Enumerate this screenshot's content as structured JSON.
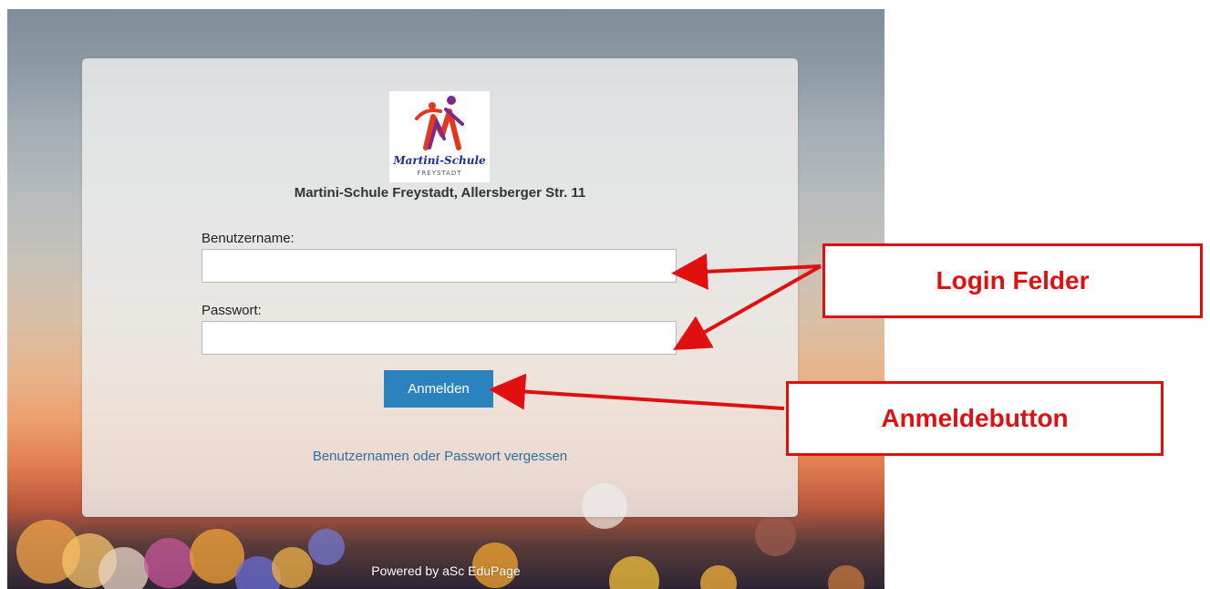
{
  "school": {
    "logo_title": "Martini-Schule",
    "logo_subtitle": "FREYSTADT",
    "name": "Martini-Schule Freystadt, Allersberger Str. 11"
  },
  "form": {
    "username_label": "Benutzername:",
    "username_value": "",
    "password_label": "Passwort:",
    "password_value": "",
    "login_button": "Anmelden",
    "forgot_link": "Benutzernamen oder Passwort vergessen"
  },
  "footer": {
    "powered_by": "Powered by aSc EduPage"
  },
  "annotations": {
    "login_fields": "Login Felder",
    "login_button": "Anmeldebutton"
  },
  "colors": {
    "button": "#2a83bf",
    "link": "#2f6ea1",
    "annotation": "#e01010"
  }
}
